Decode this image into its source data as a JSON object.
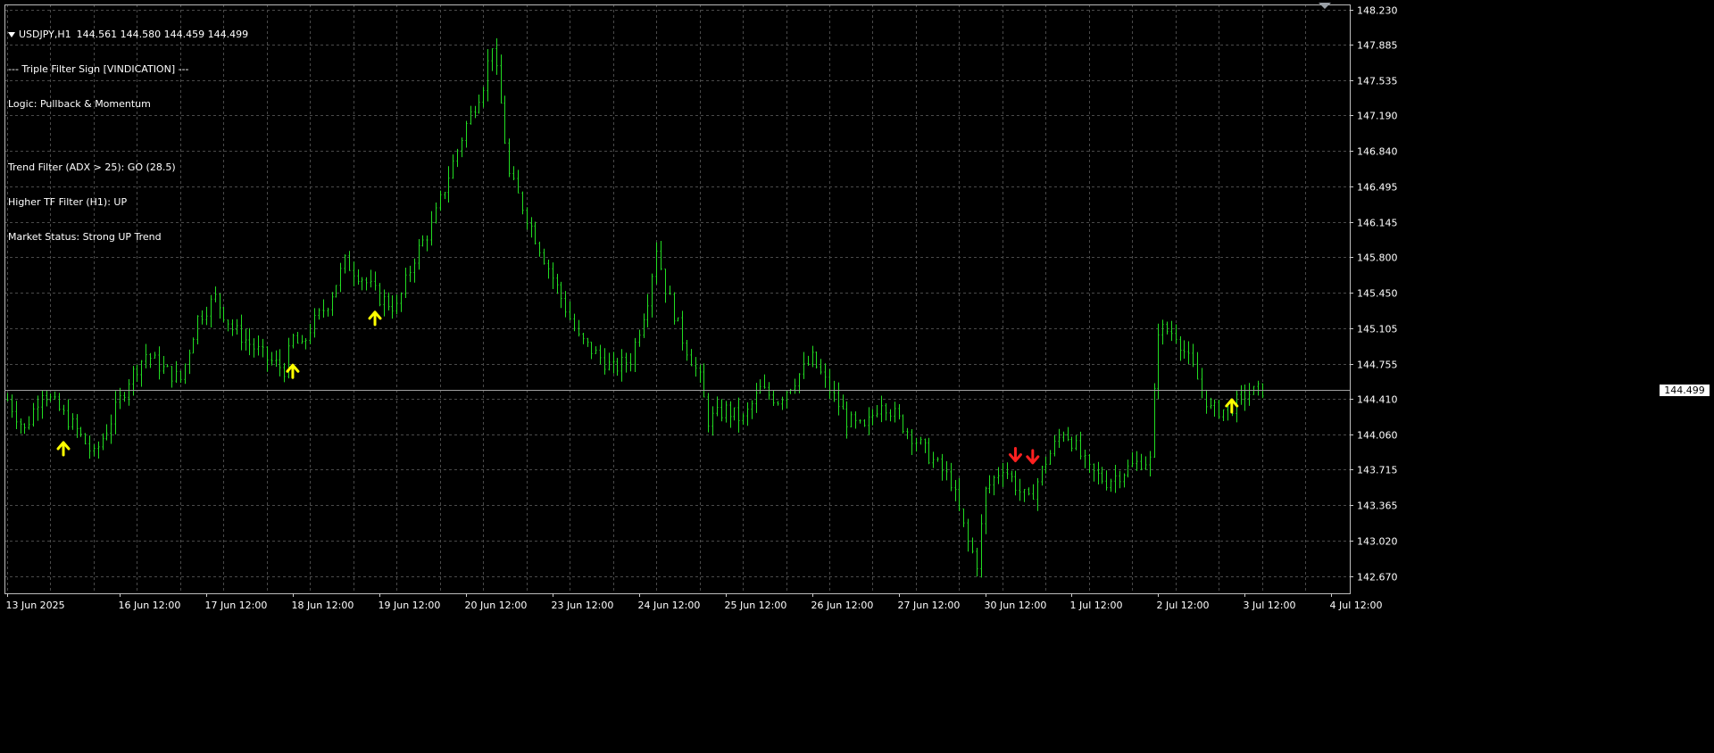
{
  "header": {
    "symbol": "USDJPY,H1",
    "ohlc": "144.561 144.580 144.459 144.499",
    "lines": [
      "--- Triple Filter Sign [VINDICATION] ---",
      "Logic: Pullback & Momentum",
      "",
      "Trend Filter (ADX > 25): GO (28.5)",
      "Higher TF Filter (H1): UP",
      "Market Status: Strong UP Trend"
    ]
  },
  "colors": {
    "background": "#000000",
    "grid": "#4a4a4a",
    "candle": "#22dd22",
    "buy_arrow": "#ffff00",
    "sell_arrow": "#ff2020",
    "axis_text": "#ffffff",
    "current_price_line": "#a0a0a0"
  },
  "chart_data": {
    "type": "line",
    "ylim": [
      142.5,
      148.28
    ],
    "y_ticks": [
      148.23,
      147.885,
      147.535,
      147.19,
      146.84,
      146.495,
      146.145,
      145.8,
      145.45,
      145.105,
      144.755,
      144.41,
      144.06,
      143.715,
      143.365,
      143.02,
      142.67
    ],
    "y_tick_labels": [
      "148.230",
      "147.885",
      "147.535",
      "147.190",
      "146.840",
      "146.495",
      "146.145",
      "145.800",
      "145.450",
      "145.105",
      "144.755",
      "144.410",
      "144.060",
      "143.715",
      "143.365",
      "143.020",
      "142.670"
    ],
    "x_ticks": [
      0,
      26,
      46,
      66,
      86,
      106,
      126,
      146,
      166,
      186,
      206,
      226,
      246,
      266,
      286,
      306
    ],
    "x_tick_labels": [
      "13 Jun 2025",
      "16 Jun 12:00",
      "17 Jun 12:00",
      "18 Jun 12:00",
      "19 Jun 12:00",
      "20 Jun 12:00",
      "23 Jun 12:00",
      "24 Jun 12:00",
      "25 Jun 12:00",
      "26 Jun 12:00",
      "27 Jun 12:00",
      "30 Jun 12:00",
      "1 Jul 12:00",
      "2 Jul 12:00",
      "3 Jul 12:00",
      "4 Jul 12:00"
    ],
    "bar_count": 308,
    "current_price": 144.499,
    "current_price_label": "144.499",
    "price_path": [
      [
        0,
        144.4
      ],
      [
        4,
        144.1
      ],
      [
        8,
        144.5
      ],
      [
        12,
        144.3
      ],
      [
        16,
        144.1
      ],
      [
        20,
        143.85
      ],
      [
        24,
        144.2
      ],
      [
        28,
        144.6
      ],
      [
        32,
        144.85
      ],
      [
        36,
        144.7
      ],
      [
        40,
        144.6
      ],
      [
        44,
        145.2
      ],
      [
        48,
        145.4
      ],
      [
        52,
        145.1
      ],
      [
        56,
        144.95
      ],
      [
        60,
        144.8
      ],
      [
        64,
        144.7
      ],
      [
        66,
        145.0
      ],
      [
        68,
        144.9
      ],
      [
        70,
        145.1
      ],
      [
        74,
        145.35
      ],
      [
        78,
        145.75
      ],
      [
        82,
        145.6
      ],
      [
        86,
        145.4
      ],
      [
        90,
        145.3
      ],
      [
        94,
        145.8
      ],
      [
        98,
        146.1
      ],
      [
        102,
        146.6
      ],
      [
        106,
        147.1
      ],
      [
        110,
        147.5
      ],
      [
        112,
        147.9
      ],
      [
        114,
        147.3
      ],
      [
        116,
        146.6
      ],
      [
        120,
        146.2
      ],
      [
        124,
        145.8
      ],
      [
        128,
        145.4
      ],
      [
        132,
        145.0
      ],
      [
        136,
        144.85
      ],
      [
        140,
        144.7
      ],
      [
        144,
        144.8
      ],
      [
        148,
        145.4
      ],
      [
        150,
        145.9
      ],
      [
        152,
        145.5
      ],
      [
        156,
        145.0
      ],
      [
        160,
        144.6
      ],
      [
        162,
        144.2
      ],
      [
        166,
        144.3
      ],
      [
        170,
        144.2
      ],
      [
        174,
        144.5
      ],
      [
        178,
        144.4
      ],
      [
        182,
        144.6
      ],
      [
        186,
        144.8
      ],
      [
        190,
        144.5
      ],
      [
        194,
        144.2
      ],
      [
        198,
        144.1
      ],
      [
        202,
        144.4
      ],
      [
        206,
        144.2
      ],
      [
        210,
        144.0
      ],
      [
        214,
        143.8
      ],
      [
        218,
        143.6
      ],
      [
        220,
        143.3
      ],
      [
        222,
        143.0
      ],
      [
        224,
        142.8
      ],
      [
        226,
        143.5
      ],
      [
        230,
        143.75
      ],
      [
        234,
        143.5
      ],
      [
        236,
        143.4
      ],
      [
        240,
        143.8
      ],
      [
        244,
        144.1
      ],
      [
        246,
        144.0
      ],
      [
        250,
        143.7
      ],
      [
        254,
        143.6
      ],
      [
        258,
        143.7
      ],
      [
        262,
        143.8
      ],
      [
        264,
        143.8
      ],
      [
        266,
        145.1
      ],
      [
        270,
        145.05
      ],
      [
        274,
        144.7
      ],
      [
        278,
        144.3
      ],
      [
        282,
        144.3
      ],
      [
        286,
        144.45
      ],
      [
        290,
        144.5
      ]
    ],
    "signals": [
      {
        "bar": 13,
        "price": 143.98,
        "dir": "buy"
      },
      {
        "bar": 66,
        "price": 144.74,
        "dir": "buy"
      },
      {
        "bar": 85,
        "price": 145.26,
        "dir": "buy"
      },
      {
        "bar": 233,
        "price": 143.8,
        "dir": "sell"
      },
      {
        "bar": 237,
        "price": 143.78,
        "dir": "sell"
      },
      {
        "bar": 283,
        "price": 144.4,
        "dir": "buy"
      }
    ]
  }
}
